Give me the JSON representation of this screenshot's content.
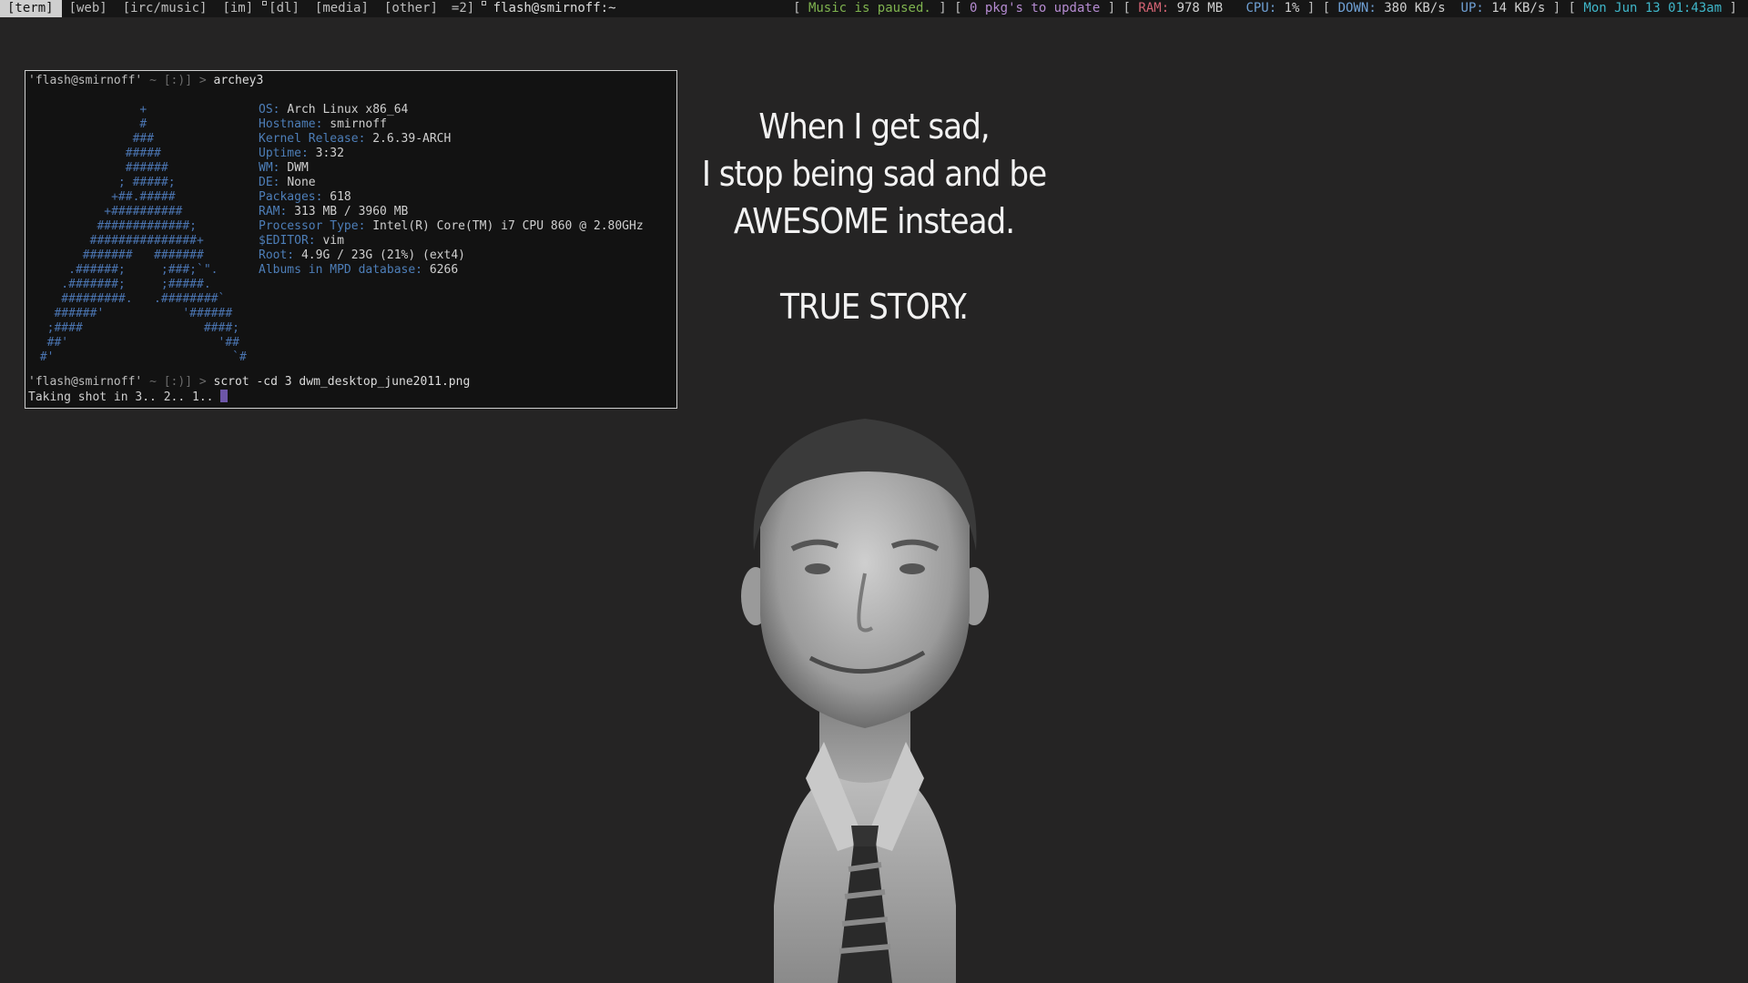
{
  "bar": {
    "tags": [
      {
        "label": "[term]",
        "selected": true,
        "occupied": false
      },
      {
        "label": "[web]",
        "selected": false,
        "occupied": false
      },
      {
        "label": "[irc/music]",
        "selected": false,
        "occupied": false
      },
      {
        "label": "[im]",
        "selected": false,
        "occupied": false
      },
      {
        "label": "[dl]",
        "selected": false,
        "occupied": true
      },
      {
        "label": "[media]",
        "selected": false,
        "occupied": false
      },
      {
        "label": "[other]",
        "selected": false,
        "occupied": false
      }
    ],
    "layout": "=2]",
    "window_title": "flash@smirnoff:~",
    "status": {
      "music": "Music is paused.",
      "pkgs": "0 pkg's to update",
      "ram_label": "RAM:",
      "ram_value": "978 MB",
      "cpu_label": "CPU:",
      "cpu_value": "1%",
      "down_label": "DOWN:",
      "down_value": "380 KB/s",
      "up_label": "UP:",
      "up_value": "14 KB/s",
      "datetime": "Mon Jun 13 01:43am"
    }
  },
  "terminal": {
    "prompt_user": "'flash@smirnoff'",
    "prompt_path": "~ [:)] >",
    "cmd1": "archey3",
    "info": [
      {
        "k": "OS:",
        "v": "Arch Linux x86_64"
      },
      {
        "k": "Hostname:",
        "v": "smirnoff"
      },
      {
        "k": "Kernel Release:",
        "v": "2.6.39-ARCH"
      },
      {
        "k": "Uptime:",
        "v": "3:32"
      },
      {
        "k": "WM:",
        "v": "DWM"
      },
      {
        "k": "DE:",
        "v": "None"
      },
      {
        "k": "Packages:",
        "v": "618"
      },
      {
        "k": "RAM:",
        "v": "313 MB / 3960 MB"
      },
      {
        "k": "Processor Type:",
        "v": "Intel(R) Core(TM) i7 CPU 860 @ 2.80GHz"
      },
      {
        "k": "$EDITOR:",
        "v": "vim"
      },
      {
        "k": "Root:",
        "v": "4.9G / 23G (21%) (ext4)"
      },
      {
        "k": "Albums in MPD database:",
        "v": "6266"
      }
    ],
    "ascii_art": [
      "               +",
      "               #",
      "              ###",
      "             #####",
      "             ######",
      "            ; #####;",
      "           +##.#####",
      "          +##########",
      "         #############;",
      "        ###############+",
      "       #######   #######",
      "     .######;     ;###;`\".",
      "    .#######;     ;#####.",
      "    #########.   .########`",
      "   ######'           '######",
      "  ;####                 ####;",
      "  ##'                     '##",
      " #'                         `#"
    ],
    "cmd2": "scrot -cd 3 dwm_desktop_june2011.png",
    "output": "Taking shot in 3.. 2.. 1.."
  },
  "quote": {
    "lines": [
      "When I get sad,",
      "I stop being sad and be",
      "AWESOME instead."
    ],
    "tagline": "TRUE STORY."
  },
  "colors": {
    "background": "#252424",
    "bar_bg": "#161616",
    "terminal_bg": "#121212",
    "key_blue": "#4d7eb8",
    "music_green": "#7fb34f",
    "pkg_purple": "#b58bd1",
    "ram_red": "#d26373",
    "date_cyan": "#3fb6c9",
    "cursor_purple": "#6d56a8"
  },
  "wallpaper": {
    "subject": "grayscale-portrait-man-in-suit"
  }
}
